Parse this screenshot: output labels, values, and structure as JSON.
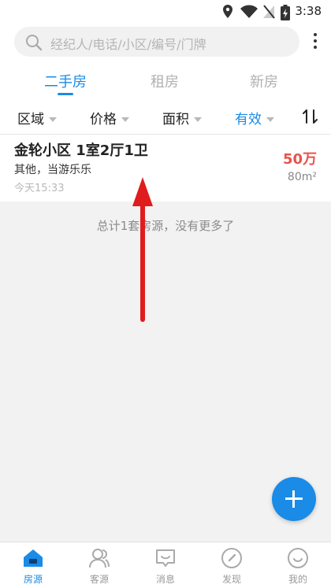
{
  "status_bar": {
    "time": "3:38"
  },
  "search": {
    "placeholder": "经纪人/电话/小区/编号/门牌"
  },
  "tabs": [
    {
      "label": "二手房",
      "active": true
    },
    {
      "label": "租房",
      "active": false
    },
    {
      "label": "新房",
      "active": false
    }
  ],
  "filters": [
    {
      "label": "区域",
      "active": false
    },
    {
      "label": "价格",
      "active": false
    },
    {
      "label": "面积",
      "active": false
    },
    {
      "label": "有效",
      "active": true
    }
  ],
  "listing": {
    "title": "金轮小区  1室2厅1卫",
    "subtitle": "其他，当游乐乐",
    "time": "今天15:33",
    "price": "50万",
    "area": "80m²"
  },
  "summary": "总计1套房源，没有更多了",
  "bottom_nav": [
    {
      "label": "房源",
      "icon": "house-icon",
      "active": true
    },
    {
      "label": "客源",
      "icon": "people-icon",
      "active": false
    },
    {
      "label": "消息",
      "icon": "message-icon",
      "active": false
    },
    {
      "label": "发现",
      "icon": "compass-icon",
      "active": false
    },
    {
      "label": "我的",
      "icon": "smiley-icon",
      "active": false
    }
  ],
  "colors": {
    "accent": "#1a8be6",
    "price": "#e8534b",
    "arrow": "#e01c1c"
  }
}
